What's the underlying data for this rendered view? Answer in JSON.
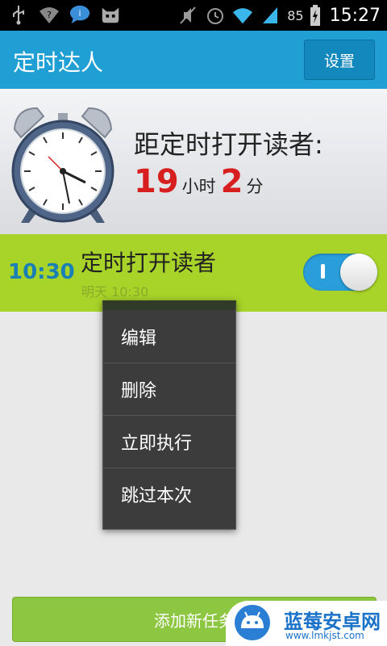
{
  "status_bar": {
    "icons_left": [
      "usb-icon",
      "wifi-question-icon",
      "chat-bubble-icon",
      "android-cat-icon"
    ],
    "icons_right": [
      "mute-icon",
      "alarm-icon",
      "wifi-icon",
      "signal-icon"
    ],
    "battery": "85",
    "time": "15:27"
  },
  "titlebar": {
    "title": "定时达人",
    "settings_label": "设置",
    "color": "#1f9fd4"
  },
  "countdown": {
    "label": "距定时打开读者:",
    "hours": "19",
    "hours_unit": "小时",
    "minutes": "2",
    "minutes_unit": "分"
  },
  "task": {
    "time": "10:30",
    "name": "定时打开读者",
    "subtitle": "明天 10:30",
    "enabled": true
  },
  "context_menu": {
    "items": [
      "编辑",
      "删除",
      "立即执行",
      "跳过本次"
    ]
  },
  "bottom": {
    "add_label": "添加新任务"
  },
  "watermark": {
    "title": "蓝莓安卓网",
    "url": "www.lmkjst.com"
  }
}
